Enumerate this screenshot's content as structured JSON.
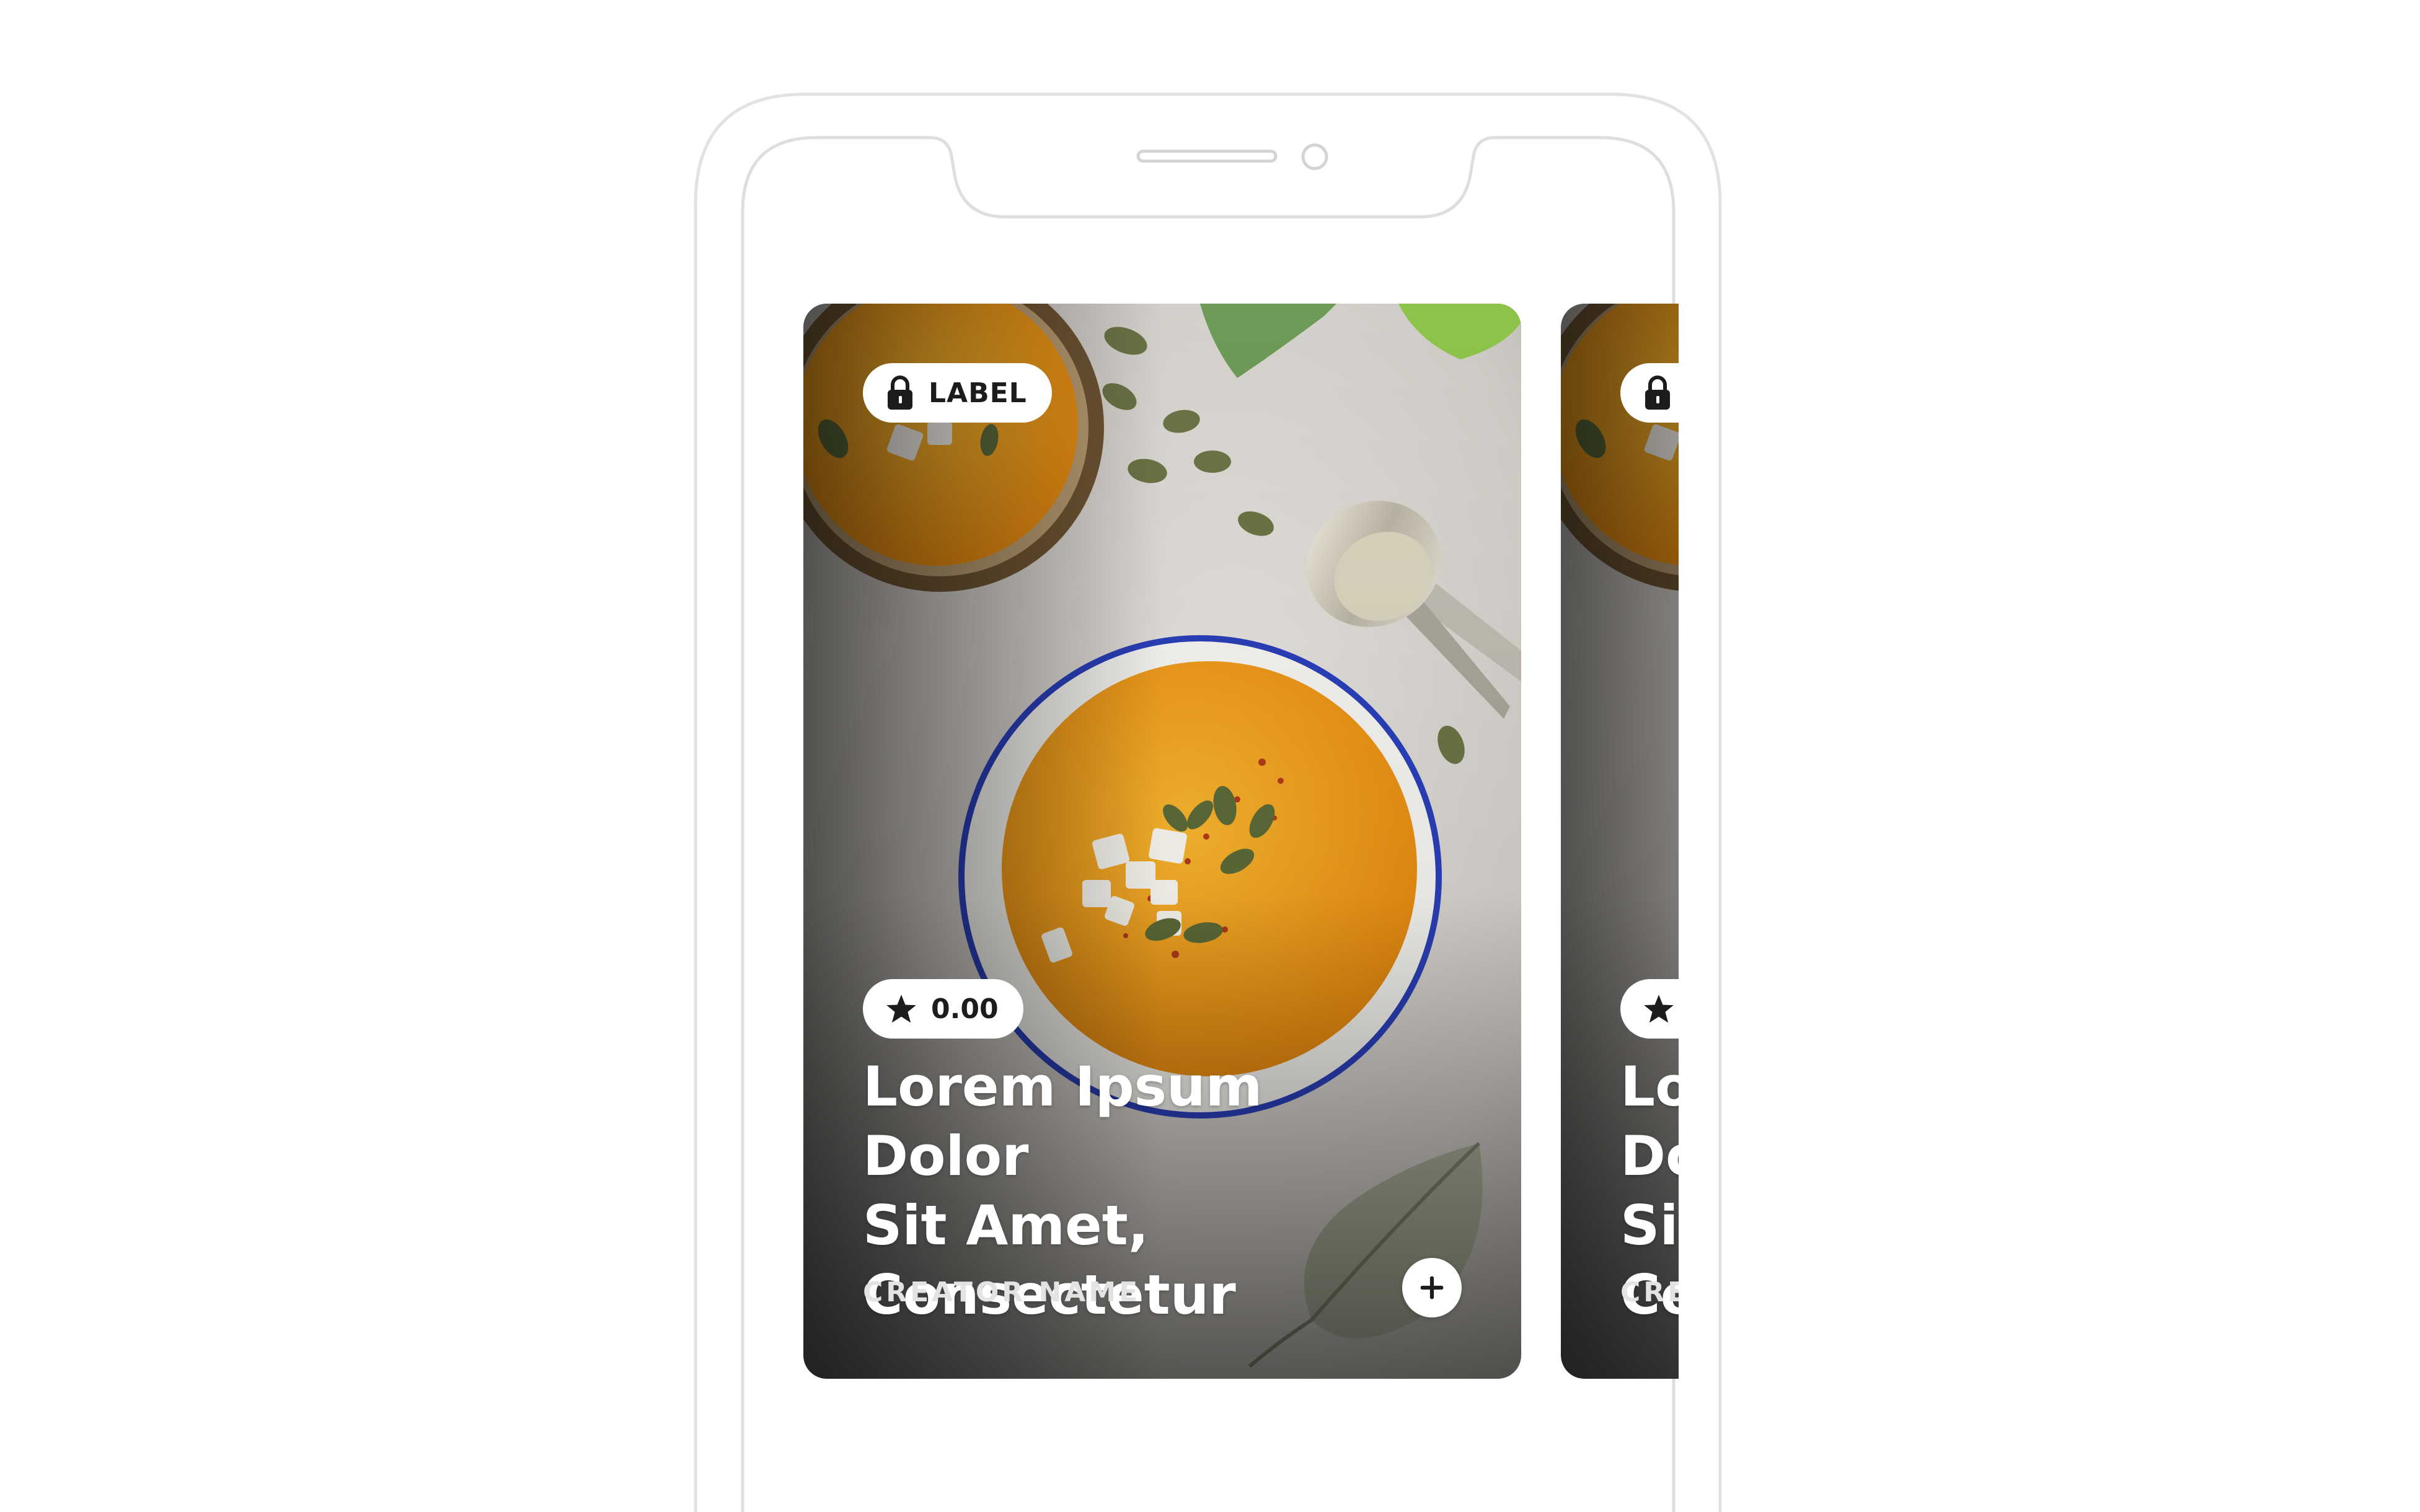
{
  "card": {
    "label_badge": "LABEL",
    "rating": "0.00",
    "title_line1": "Lorem Ipsum Dolor",
    "title_line2": "Sit Amet,",
    "title_line3": "Consectetur",
    "creator": "CREATOR NAME",
    "icons": {
      "lock": "lock-icon",
      "star": "star-icon",
      "add": "plus-icon"
    }
  },
  "colors": {
    "soup": "#f0a21e",
    "bowl_rim": "#2a3fb8",
    "badge_bg": "#ffffff",
    "text_dark": "#1c1c1c",
    "phone_outline": "#d9d9d9"
  }
}
